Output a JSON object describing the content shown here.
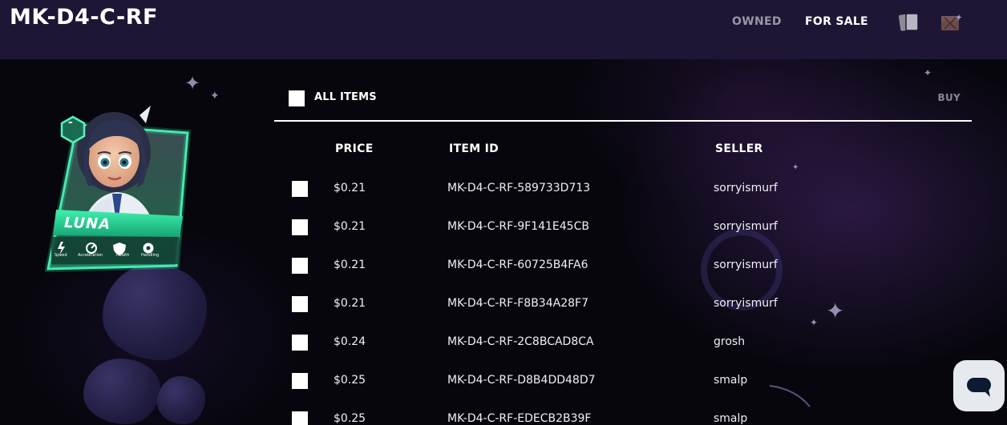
{
  "header": {
    "title": "MK-D4-C-RF",
    "tabs": [
      {
        "label": "OWNED",
        "active": false
      },
      {
        "label": "FOR SALE",
        "active": true
      }
    ],
    "icons": [
      "cards-icon",
      "crate-icon"
    ]
  },
  "card": {
    "character_name": "LUNA",
    "level_badge": "-",
    "stats": [
      "Speed",
      "Acceleration",
      "Health",
      "Handling"
    ]
  },
  "listing": {
    "select_all_label": "ALL ITEMS",
    "buy_label": "BUY",
    "columns": {
      "price": "PRICE",
      "item_id": "ITEM ID",
      "seller": "SELLER"
    },
    "rows": [
      {
        "price": "$0.21",
        "item_id": "MK-D4-C-RF-589733D713",
        "seller": "sorryismurf"
      },
      {
        "price": "$0.21",
        "item_id": "MK-D4-C-RF-9F141E45CB",
        "seller": "sorryismurf"
      },
      {
        "price": "$0.21",
        "item_id": "MK-D4-C-RF-60725B4FA6",
        "seller": "sorryismurf"
      },
      {
        "price": "$0.21",
        "item_id": "MK-D4-C-RF-F8B34A28F7",
        "seller": "sorryismurf"
      },
      {
        "price": "$0.24",
        "item_id": "MK-D4-C-RF-2C8BCAD8CA",
        "seller": "grosh"
      },
      {
        "price": "$0.25",
        "item_id": "MK-D4-C-RF-D8B4DD48D7",
        "seller": "smalp"
      },
      {
        "price": "$0.25",
        "item_id": "MK-D4-C-RF-EDECB2B39F",
        "seller": "smalp"
      }
    ]
  },
  "colors": {
    "header_bg": "#1e1634",
    "accent_green": "#2fd39a",
    "tab_inactive": "#9a95a6",
    "buy_inactive": "#8a8696"
  }
}
